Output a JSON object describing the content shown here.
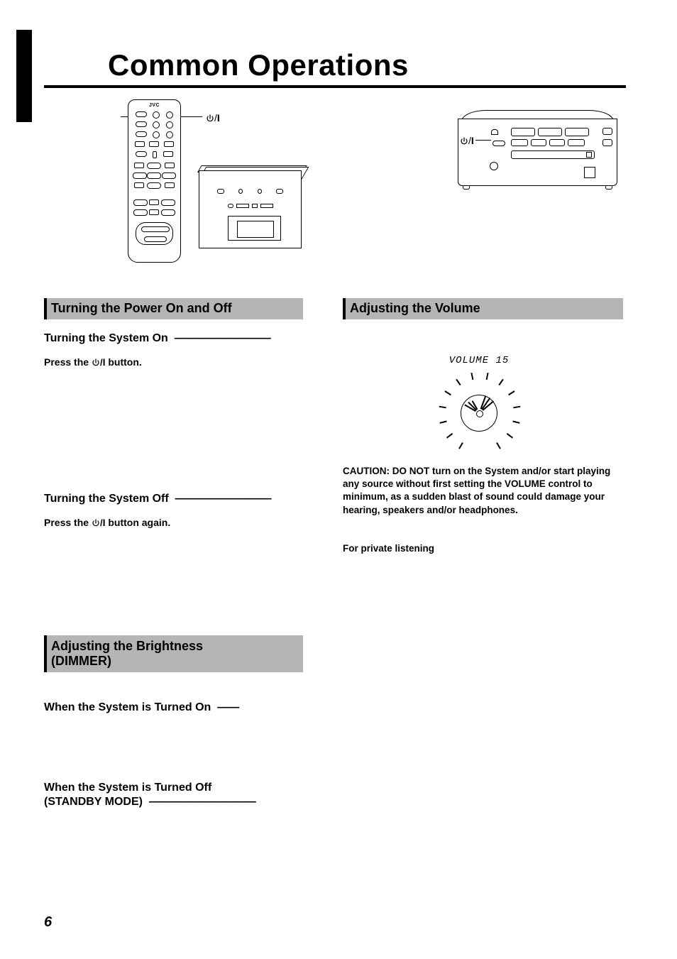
{
  "page": {
    "title": "Common Operations",
    "number": "6"
  },
  "remote": {
    "brand": "JVC"
  },
  "icons": {
    "power_label": "⏻/I"
  },
  "volume": {
    "display": "VOLUME 15"
  },
  "sections": {
    "power": {
      "heading": "Turning the Power On and Off",
      "on_sub": "Turning the System On",
      "on_instr_pre": "Press the ",
      "on_instr_post": " button.",
      "off_sub": "Turning the System Off",
      "off_instr_pre": "Press the ",
      "off_instr_post": " button again."
    },
    "volume_sec": {
      "heading": "Adjusting the Volume",
      "caution": "CAUTION: DO NOT turn on the System and/or start playing any source without first setting the VOLUME control to minimum, as a sudden blast of sound could damage your hearing, speakers and/or headphones.",
      "private": "For private listening"
    },
    "dimmer": {
      "heading_l1": "Adjusting the Brightness",
      "heading_l2": "(DIMMER)",
      "on_sub": "When the System is Turned On",
      "off_sub_l1": "When the System is Turned Off",
      "off_sub_l2": "(STANDBY MODE)"
    }
  },
  "dashes": {
    "short": "—————————",
    "shorter": "——",
    "med": "——————————"
  }
}
